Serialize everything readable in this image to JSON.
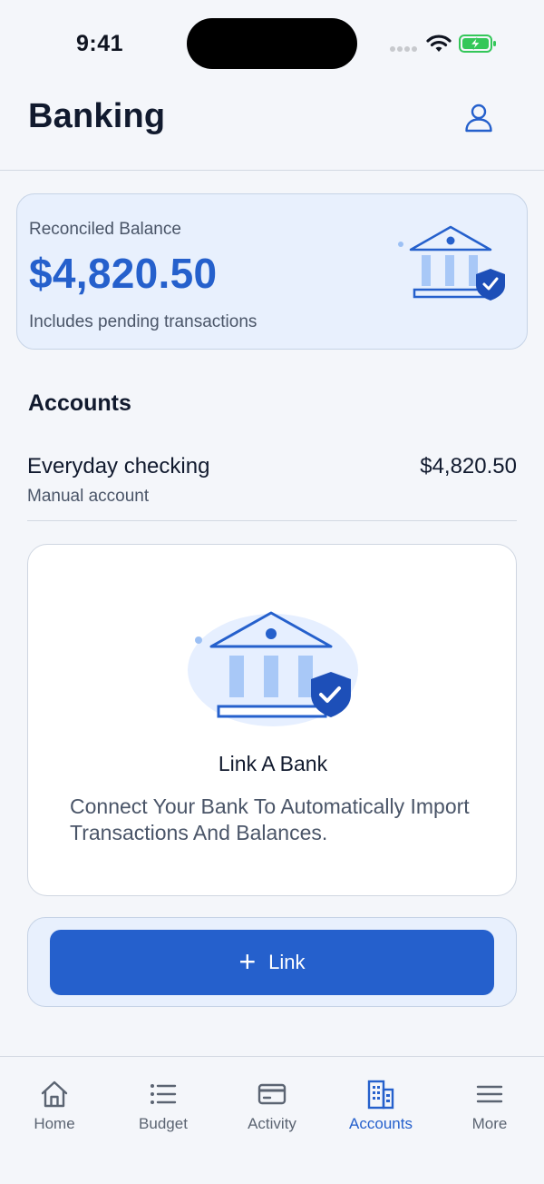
{
  "status_bar": {
    "time": "9:41"
  },
  "header": {
    "title": "Banking",
    "profile_icon": "person-icon"
  },
  "balance_card": {
    "label": "Reconciled Balance",
    "amount": "$4,820.50",
    "note": "Includes pending transactions",
    "illustration_icon": "bank-shield-icon"
  },
  "accounts": {
    "title": "Accounts",
    "items": [
      {
        "name": "Everyday checking",
        "type": "Manual account",
        "balance": "$4,820.50"
      }
    ]
  },
  "link_card": {
    "illustration_icon": "bank-shield-icon",
    "title": "Link A Bank",
    "description": "Connect Your Bank To Automatically Import Transactions And Balances."
  },
  "link_button": {
    "label": "Link",
    "icon": "plus-icon"
  },
  "tab_bar": {
    "tabs": [
      {
        "label": "Home",
        "icon": "home-icon",
        "active": false
      },
      {
        "label": "Budget",
        "icon": "list-icon",
        "active": false
      },
      {
        "label": "Activity",
        "icon": "card-icon",
        "active": false
      },
      {
        "label": "Accounts",
        "icon": "building-icon",
        "active": true
      },
      {
        "label": "More",
        "icon": "menu-icon",
        "active": false
      }
    ]
  },
  "colors": {
    "accent": "#2560cc",
    "card_tint": "#e8f0fd",
    "background": "#f4f6fa",
    "text_primary": "#111a2e",
    "text_secondary": "#4a5568",
    "battery_green": "#34c759"
  }
}
